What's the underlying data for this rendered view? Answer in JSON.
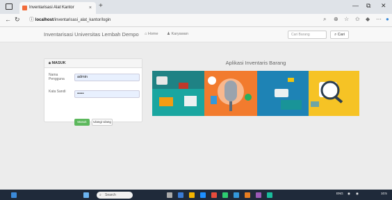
{
  "browser": {
    "tab_title": "Inventarisasi Alat Kantor",
    "tab_close": "×",
    "new_tab": "+",
    "url_host": "localhost",
    "url_path": "/inventarisasi_alat_kantor/login",
    "window_controls": [
      "—",
      "⧉",
      "✕"
    ]
  },
  "navbar": {
    "brand": "Inventarisasi Universitas Lembah Dempo",
    "menu": [
      {
        "label": "Home",
        "icon": "home-icon"
      },
      {
        "label": "Karyawan",
        "icon": "user-icon"
      }
    ],
    "search_placeholder": "Cari Barang",
    "search_button": "Cari"
  },
  "login": {
    "heading": "MASUK",
    "username_label": "Nama Pengguna",
    "username_value": "admin",
    "password_label": "Kata Sandi",
    "password_value": "•••••",
    "submit_label": "Masuk",
    "reset_label": "Ulangi Ulang"
  },
  "main": {
    "app_title": "Aplikasi Inventaris Barang"
  },
  "taskbar": {
    "search_placeholder": "Search",
    "language": "ENG",
    "time": "10:5"
  },
  "colors": {
    "success": "#5cb85c",
    "banner_teal": "#1aa6a0",
    "banner_orange": "#f27b2e",
    "banner_yellow": "#f6c325",
    "banner_blue": "#1e83b5"
  }
}
